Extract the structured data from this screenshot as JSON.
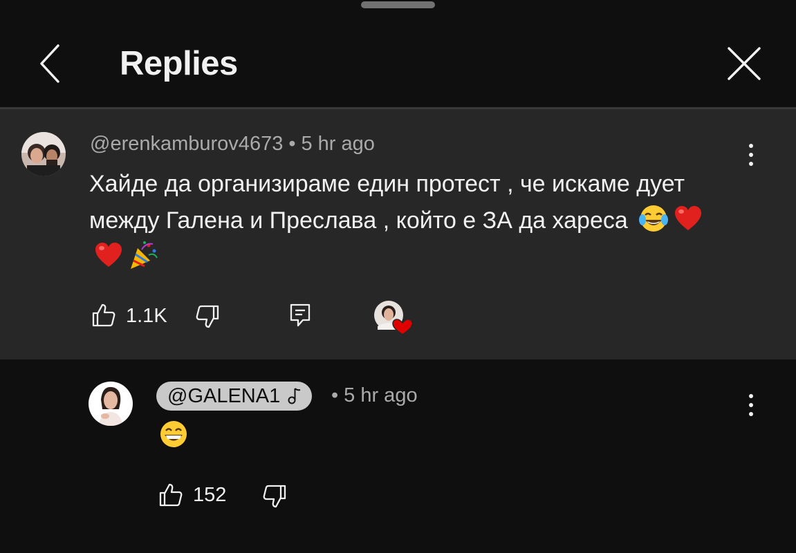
{
  "header": {
    "title": "Replies"
  },
  "parent_comment": {
    "author": "@erenkamburov4673",
    "separator": "•",
    "time": "5 hr ago",
    "text": "Хайде да организираме един протест , че искаме дует между Галена и Преслава , който е ЗА да хареса",
    "emojis": [
      "tears-of-joy-emoji",
      "red-heart-emoji",
      "red-heart-emoji",
      "party-popper-emoji"
    ],
    "like_count": "1.1K"
  },
  "reply": {
    "author": "@GALENA1",
    "separator": "•",
    "time": "5 hr ago",
    "text_emoji": "grinning-face-emoji",
    "like_count": "152"
  },
  "colors": {
    "background": "#0f0f0f",
    "highlight_background": "#272727",
    "primary_text": "#f1f1f1",
    "secondary_text": "#aaaaaa",
    "heart": "#e00000"
  }
}
